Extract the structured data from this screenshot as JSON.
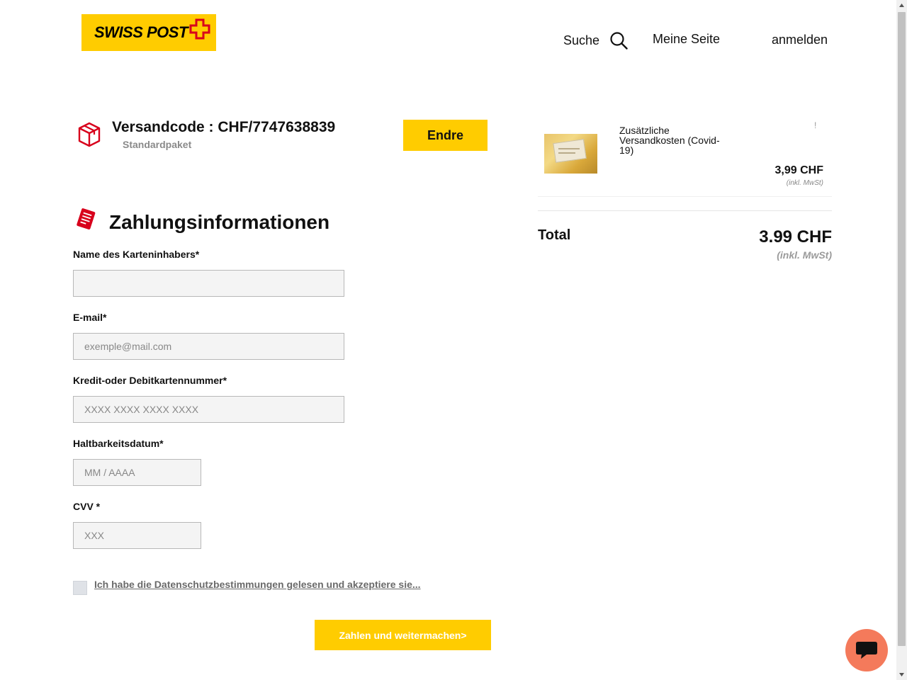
{
  "header": {
    "logo_text": "SWISS POST",
    "search_label": "Suche",
    "my_page_label": "Meine Seite",
    "login_label": "anmelden"
  },
  "shipment": {
    "code_label": "Versandcode : CHF/7747638839",
    "type": "Standardpaket",
    "change_button": "Endre"
  },
  "payment": {
    "title": "Zahlungsinformationen",
    "fields": [
      {
        "label": "Name des Karteninhabers*",
        "value": "",
        "placeholder": ""
      },
      {
        "label": "E-mail*",
        "value": "",
        "placeholder": "exemple@mail.com"
      },
      {
        "label": "Kredit-oder Debitkartennummer*",
        "value": "",
        "placeholder": "XXXX XXXX XXXX XXXX"
      },
      {
        "label": "Haltbarkeitsdatum*",
        "value": "",
        "placeholder": "MM / AAAA"
      },
      {
        "label": "CVV *",
        "value": "",
        "placeholder": "XXX"
      }
    ],
    "consent_text": "Ich habe die Datenschutzbestimmungen gelesen und akzeptiere sie...",
    "consent_checked": false,
    "submit_button": "Zahlen und weitermachen>"
  },
  "summary": {
    "item": {
      "name": "Zusätzliche Versandkosten (Covid-19)",
      "info_marker": "!",
      "price": "3,99 CHF",
      "vat_note": "(inkl. MwSt)"
    },
    "total_label": "Total",
    "total_amount": "3.99 CHF",
    "total_vat_note": "(inkl. MwSt)"
  },
  "colors": {
    "brand_yellow": "#ffcc00",
    "brand_red": "#d8001c",
    "chat_bubble": "#f47a5b"
  },
  "icons": {
    "search": "search-icon",
    "package": "package-icon",
    "payment": "receipt-icon",
    "chat": "chat-icon"
  }
}
